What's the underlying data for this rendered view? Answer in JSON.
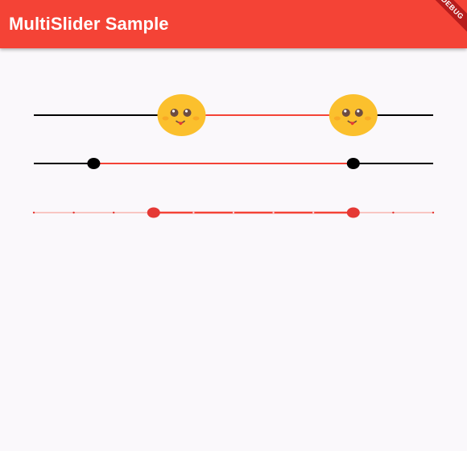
{
  "app_bar": {
    "title": "MultiSlider Sample",
    "color": "#f44336",
    "debug_banner": "DEBUG"
  },
  "colors": {
    "active_track": "#f44336",
    "inactive_track": "#000000",
    "discrete_inactive": "#f8c6c2",
    "emoji_face": "#fbc02d",
    "black_thumb": "#000000",
    "red_thumb": "#e53935"
  },
  "sliders": [
    {
      "name": "emoji-slider",
      "values": [
        0.37,
        0.8
      ],
      "thumb": "emoji-face-icon",
      "divisions": null
    },
    {
      "name": "black-thumb-slider",
      "values": [
        0.15,
        0.8
      ],
      "thumb": "black-dot",
      "divisions": null
    },
    {
      "name": "discrete-slider",
      "values": [
        0.3,
        0.8
      ],
      "thumb": "red-dot",
      "divisions": 10
    }
  ]
}
